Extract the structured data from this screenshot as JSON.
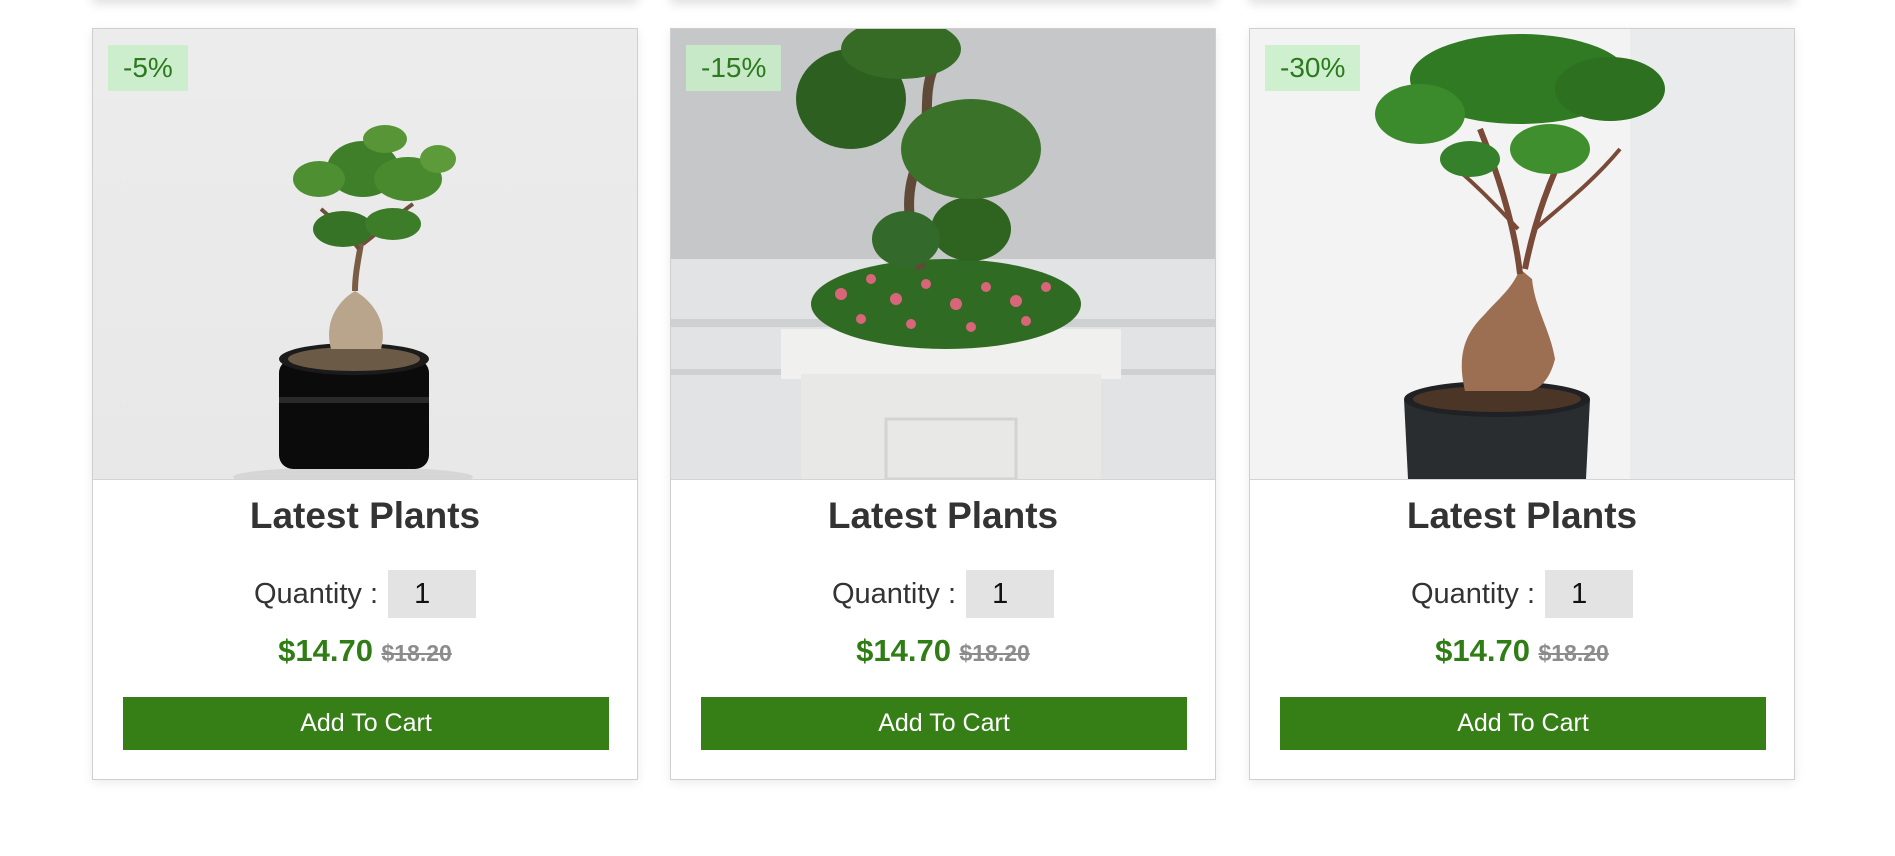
{
  "products": [
    {
      "title": "Latest Plants",
      "discount": "-5%",
      "quantity_label": "Quantity :",
      "quantity": "1",
      "price": "$14.70",
      "old_price": "$18.20",
      "button": "Add To Cart",
      "image": "bonsai-black-pot"
    },
    {
      "title": "Latest Plants",
      "discount": "-15%",
      "quantity_label": "Quantity :",
      "quantity": "1",
      "price": "$14.70",
      "old_price": "$18.20",
      "button": "Add To Cart",
      "image": "bonsai-white-planter"
    },
    {
      "title": "Latest Plants",
      "discount": "-30%",
      "quantity_label": "Quantity :",
      "quantity": "1",
      "price": "$14.70",
      "old_price": "$18.20",
      "button": "Add To Cart",
      "image": "bonsai-dark-pot"
    }
  ],
  "colors": {
    "accent_green": "#367f16",
    "price_green": "#2f7d14",
    "badge_bg": "#c8eec8"
  }
}
